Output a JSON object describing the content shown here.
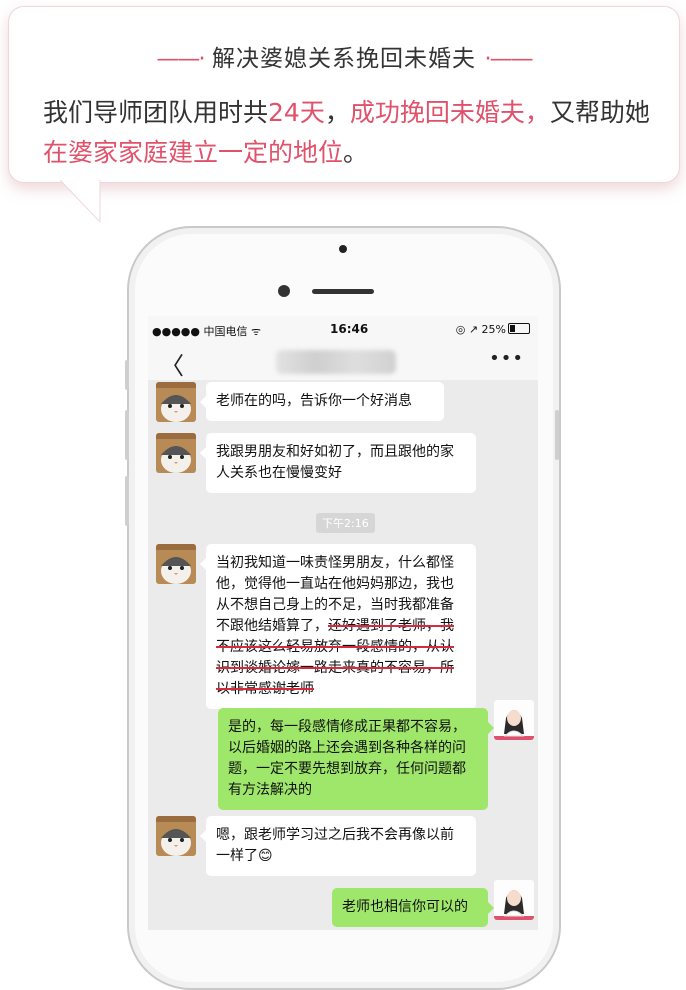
{
  "banner": {
    "dash_left": "——·",
    "title": "解决婆媳关系挽回未婚夫",
    "dash_right": "·——",
    "line_a": "我们导师团队用时共",
    "days": "24天",
    "comma": "，",
    "success": "成功挽回未婚夫，",
    "line_b": "又帮助她",
    "status": "在婆家家庭建立一定的地位",
    "period": "。"
  },
  "status_bar": {
    "carrier": "●●●●● 中国电信 ᯤ",
    "time": "16:46",
    "battery_text": "◎ ↗ 25%",
    "battery_level": 0.25
  },
  "nav": {
    "back": "〈",
    "more": "•••"
  },
  "chat": {
    "timestamp": "下午2:16",
    "m1": "老师在的吗，告诉你一个好消息",
    "m2": "我跟男朋友和好如初了，而且跟他的家人关系也在慢慢变好",
    "m3_plain": "当初我知道一味责怪男朋友，什么都怪他，觉得他一直站在他妈妈那边，我也从不想自己身上的不足，当时我都准备不跟他结婚算了，",
    "m3_struck": "还好遇到了老师，我不应该这么轻易放弃一段感情的，从认识到谈婚论嫁一路走来真的不容易，所以非常感谢老师",
    "m4": "是的，每一段感情修成正果都不容易，以后婚姻的路上还会遇到各种各样的问题，一定不要先想到放弃，任何问题都有方法解决的",
    "m5": "嗯，跟老师学习过之后我不会再像以前一样了😊",
    "m6": "老师也相信你可以的"
  },
  "colors": {
    "accent": "#e0526b",
    "bubble_out": "#9fe76a",
    "chat_bg": "#ebebeb"
  }
}
